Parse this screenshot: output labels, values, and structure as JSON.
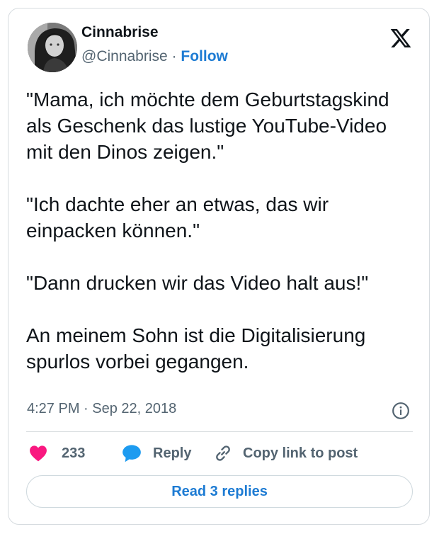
{
  "author": {
    "display_name": "Cinnabrise",
    "handle": "@Cinnabrise",
    "separator": " · ",
    "follow_label": "Follow"
  },
  "tweet": {
    "paragraphs": [
      "\"Mama, ich möchte dem Geburtstagskind als Geschenk das lustige YouTube-Video mit den Dinos zeigen.\"",
      "\"Ich dachte eher an etwas, das wir einpacken können.\"",
      "\"Dann drucken wir das Video halt aus!\"",
      "An meinem Sohn ist die Digitalisierung spurlos vorbei gegangen."
    ],
    "timestamp": "4:27 PM · Sep 22, 2018"
  },
  "actions": {
    "like_count": "233",
    "reply_label": "Reply",
    "copy_link_label": "Copy link to post"
  },
  "footer": {
    "read_replies_label": "Read 3 replies"
  },
  "colors": {
    "accent": "#1d7bd3",
    "like": "#f91880",
    "reply_bubble": "#1d9bf0",
    "muted": "#536471",
    "text": "#0f1419"
  },
  "icons": {
    "logo": "x-logo-icon",
    "info": "info-icon",
    "like": "heart-icon",
    "reply": "speech-bubble-icon",
    "copy": "link-icon"
  }
}
